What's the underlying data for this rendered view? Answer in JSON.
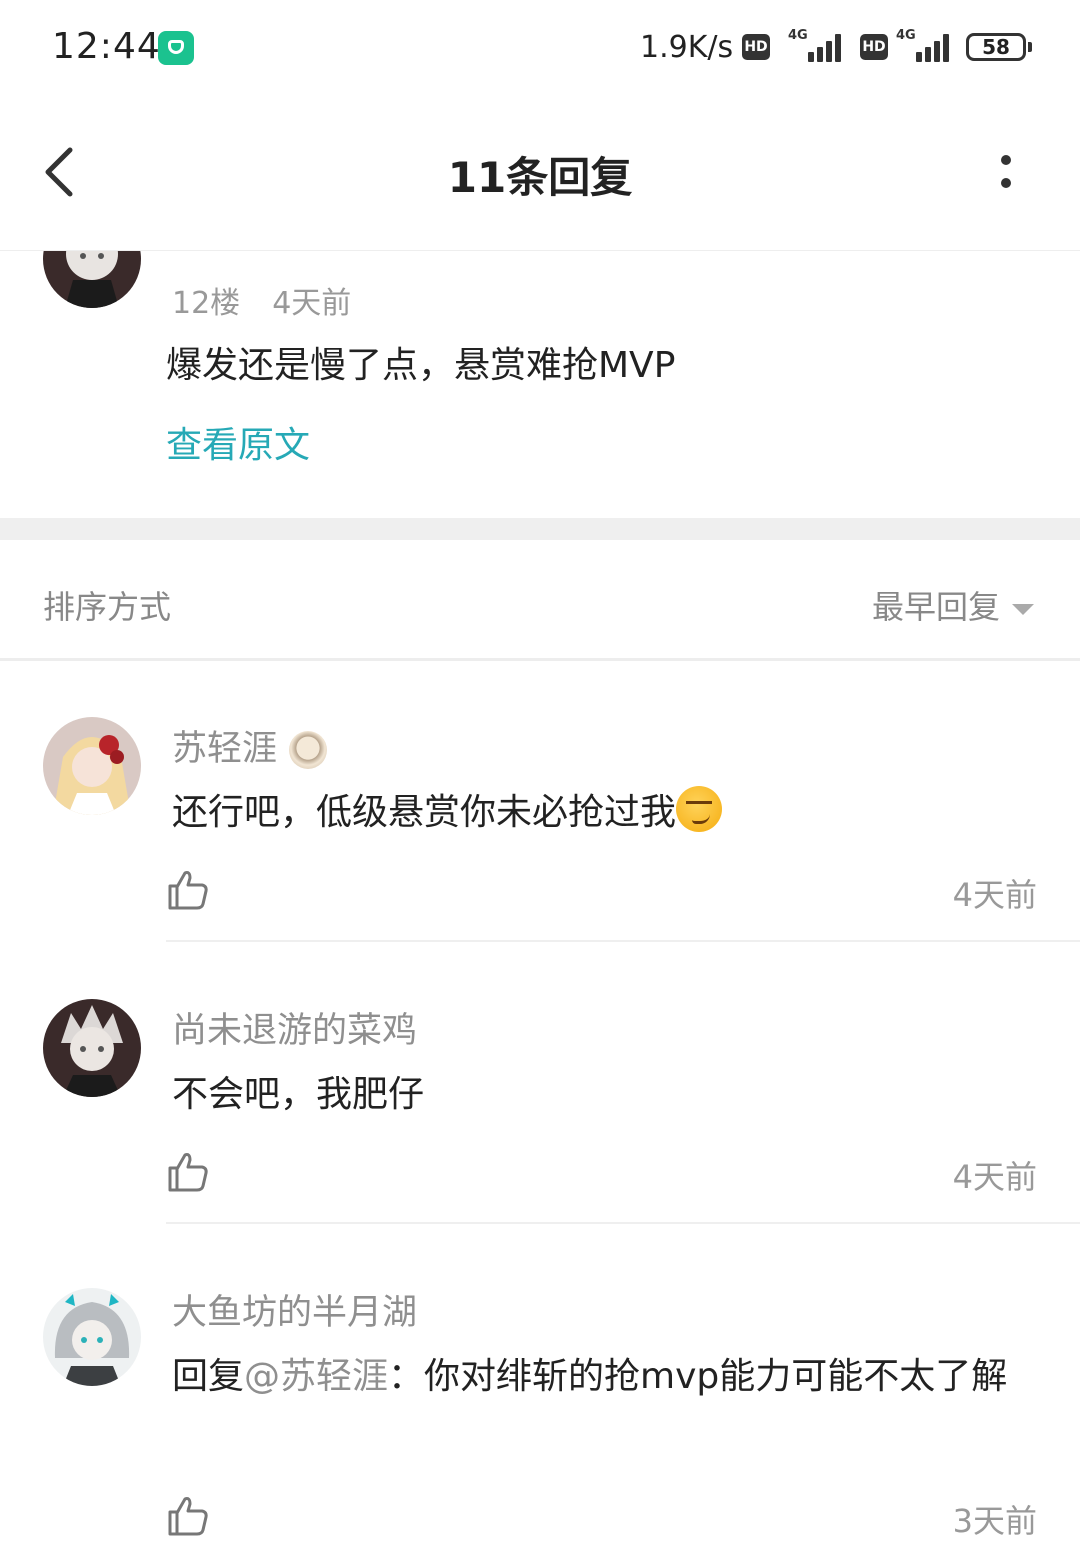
{
  "status_bar": {
    "time": "12:44",
    "net_speed": "1.9K/s",
    "hd_label": "HD",
    "network_type": "4G",
    "battery": "58"
  },
  "header": {
    "title": "11条回复",
    "back_icon": "chevron-left-icon",
    "more_icon": "more-vertical-icon"
  },
  "post": {
    "floor": "12楼",
    "time": "4天前",
    "text": "爆发还是慢了点，悬赏难抢MVP",
    "view_original": "查看原文"
  },
  "sort": {
    "label": "排序方式",
    "selected": "最早回复"
  },
  "comments": [
    {
      "username": "苏轻涯",
      "text": "还行吧，低级悬赏你未必抢过我",
      "time": "4天前"
    },
    {
      "username": "尚未退游的菜鸡",
      "text": "不会吧，我肥仔",
      "time": "4天前"
    },
    {
      "username": "大鱼坊的半月湖",
      "reply_prefix": "回复",
      "mention": "@苏轻涯",
      "text": "：你对绯斩的抢mvp能力可能不太了解",
      "time": "3天前"
    }
  ],
  "colors": {
    "accent": "#26a9b6",
    "muted_text": "#8f8f8f",
    "primary_text": "#222222",
    "separator": "#efefef"
  }
}
